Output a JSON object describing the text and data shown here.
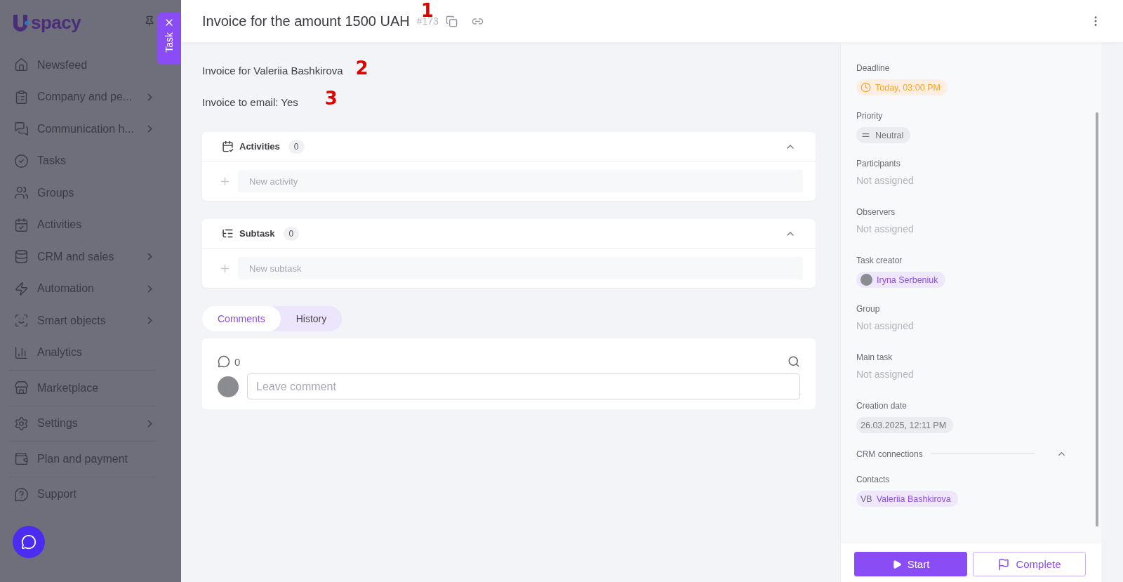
{
  "sidebar": {
    "logo": "spacy",
    "sections": [
      [
        {
          "label": "Newsfeed",
          "has_submenu": false
        },
        {
          "label": "Company and pe...",
          "has_submenu": true
        },
        {
          "label": "Communication h...",
          "has_submenu": true
        },
        {
          "label": "Tasks",
          "has_submenu": false
        },
        {
          "label": "Groups",
          "has_submenu": false
        },
        {
          "label": "Activities",
          "has_submenu": false
        },
        {
          "label": "CRM and sales",
          "has_submenu": true
        },
        {
          "label": "Automation",
          "has_submenu": true
        },
        {
          "label": "Smart objects",
          "has_submenu": true
        },
        {
          "label": "Analytics",
          "has_submenu": false
        }
      ],
      [
        {
          "label": "Marketplace",
          "has_submenu": false
        }
      ],
      [
        {
          "label": "Settings",
          "has_submenu": true
        }
      ],
      [
        {
          "label": "Plan and payment",
          "has_submenu": false
        }
      ],
      [
        {
          "label": "Support",
          "has_submenu": false
        }
      ]
    ]
  },
  "panel_tab": {
    "label": "Task"
  },
  "header": {
    "title": "Invoice for the amount 1500 UAH",
    "id": "#173"
  },
  "description": [
    "Invoice for Valeriia Bashkirova",
    "Invoice to email: Yes"
  ],
  "annotations": [
    "1",
    "2",
    "3"
  ],
  "sections": [
    {
      "title": "Activities",
      "count": "0",
      "placeholder": "New activity",
      "expanded": true
    },
    {
      "title": "Subtask",
      "count": "0",
      "placeholder": "New subtask",
      "expanded": true
    }
  ],
  "tabs": [
    {
      "label": "Comments",
      "selected": true
    },
    {
      "label": "History",
      "selected": false
    }
  ],
  "comments": {
    "count": "0",
    "placeholder": "Leave comment"
  },
  "details": [
    {
      "kind": "deadline",
      "label": "Deadline",
      "value": "Today, 03:00 PM"
    },
    {
      "kind": "priority",
      "label": "Priority",
      "value": "Neutral"
    },
    {
      "kind": "empty",
      "label": "Participants",
      "value": "Not assigned"
    },
    {
      "kind": "empty",
      "label": "Observers",
      "value": "Not assigned"
    },
    {
      "kind": "person",
      "label": "Task creator",
      "value": "Iryna Serbeniuk"
    },
    {
      "kind": "empty",
      "label": "Group",
      "value": "Not assigned"
    },
    {
      "kind": "empty",
      "label": "Main task",
      "value": "Not assigned"
    },
    {
      "kind": "date",
      "label": "Creation date",
      "value": "26.03.2025, 12:11 PM"
    },
    {
      "kind": "section",
      "label": "CRM connections",
      "expanded": true
    },
    {
      "kind": "contact",
      "label": "Contacts",
      "initials": "VB",
      "value": "Valeriia Bashkirova"
    }
  ],
  "actions": [
    {
      "label": "Start",
      "kind": "primary"
    },
    {
      "label": "Complete",
      "kind": "outline"
    }
  ]
}
